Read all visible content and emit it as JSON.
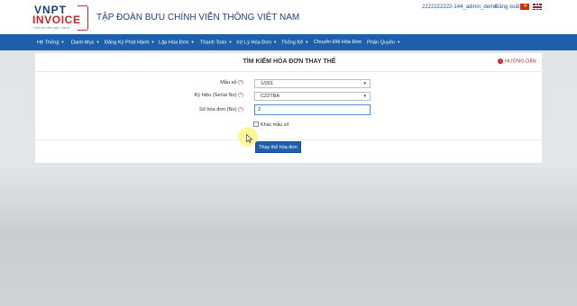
{
  "header": {
    "logo_line1": "VNPT",
    "logo_line2": "INVOICE",
    "logo_tagline": "Hóa đơn tiện nghi. Giá trị",
    "company": "TẬP ĐOÀN BƯU CHÍNH VIỄN THÔNG VIỆT NAM",
    "user": "2222222222-144_admin_demo",
    "logout": "Đăng xuất",
    "flags": [
      "flag-vn-icon",
      "flag-uk-icon"
    ]
  },
  "nav": {
    "items": [
      "Hệ Thống",
      "Danh Mục",
      "Đăng Ký Phát Hành",
      "Lập Hóa Đơn",
      "Thanh Toán",
      "Xử Lý Hóa Đơn",
      "Thống Kê",
      "Chuyển Đổi Hóa Đơn",
      "Phân Quyền"
    ],
    "has_caret": [
      true,
      true,
      true,
      true,
      true,
      true,
      true,
      false,
      true
    ]
  },
  "panel": {
    "title": "TÌM KIẾM HÓA ĐƠN THAY THẾ",
    "guide": "HƯỚNG DẪN",
    "form": {
      "mau_so_label": "Mẫu số",
      "mau_so_value": "1/001",
      "ky_hieu_label": "Ký hiệu (Serial No)",
      "ky_hieu_value": "C22TBA",
      "so_hoa_don_label": "Số hóa đơn (No)",
      "so_hoa_don_value": "2",
      "required_mark": "(*)",
      "checkbox_label": "Khác mẫu số",
      "checkbox_checked": false
    },
    "submit_label": "Thay thế hóa đơn"
  },
  "colors": {
    "nav": "#1e5fad",
    "brand_red": "#c0272d",
    "brand_blue": "#1d3f7c"
  }
}
